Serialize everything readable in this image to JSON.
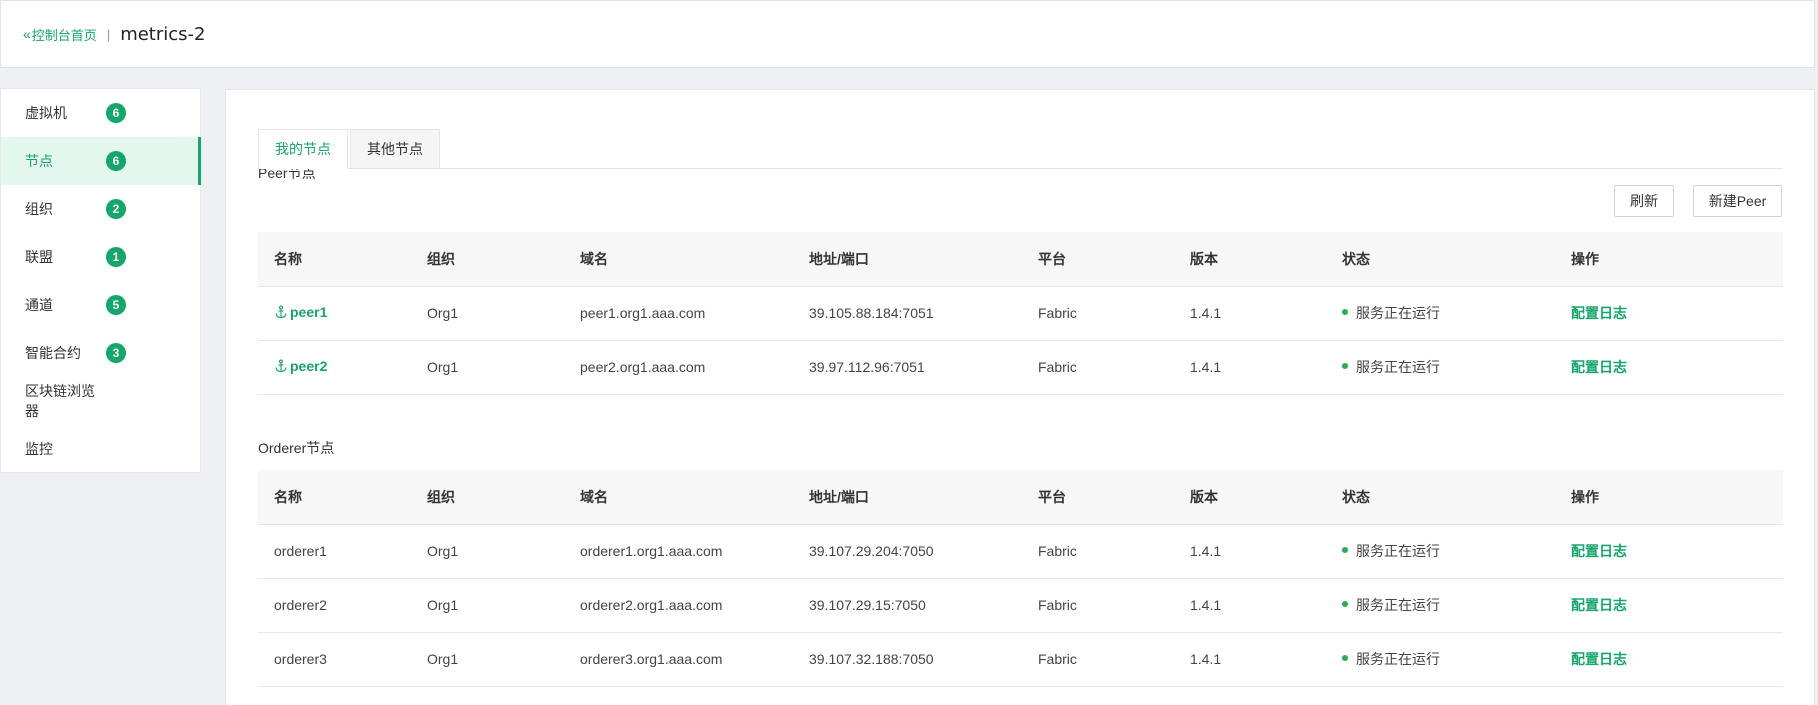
{
  "header": {
    "back_label": "控制台首页",
    "separator": "|",
    "title": "metrics-2"
  },
  "sidebar": {
    "items": [
      {
        "label": "虚拟机",
        "badge": "6"
      },
      {
        "label": "节点",
        "badge": "6"
      },
      {
        "label": "组织",
        "badge": "2"
      },
      {
        "label": "联盟",
        "badge": "1"
      },
      {
        "label": "通道",
        "badge": "5"
      },
      {
        "label": "智能合约",
        "badge": "3"
      },
      {
        "label": "区块链浏览器"
      },
      {
        "label": "监控"
      }
    ]
  },
  "tabs": [
    "我的节点",
    "其他节点"
  ],
  "peer_section": {
    "title": "Peer节点",
    "refresh_label": "刷新",
    "new_label": "新建Peer",
    "columns": [
      "名称",
      "组织",
      "域名",
      "地址/端口",
      "平台",
      "版本",
      "状态",
      "操作"
    ],
    "rows": [
      {
        "name": "peer1",
        "org": "Org1",
        "domain": "peer1.org1.aaa.com",
        "address": "39.105.88.184:7051",
        "platform": "Fabric",
        "version": "1.4.1",
        "status": "服务正在运行",
        "action": "配置日志"
      },
      {
        "name": "peer2",
        "org": "Org1",
        "domain": "peer2.org1.aaa.com",
        "address": "39.97.112.96:7051",
        "platform": "Fabric",
        "version": "1.4.1",
        "status": "服务正在运行",
        "action": "配置日志"
      }
    ]
  },
  "orderer_section": {
    "title": "Orderer节点",
    "columns": [
      "名称",
      "组织",
      "域名",
      "地址/端口",
      "平台",
      "版本",
      "状态",
      "操作"
    ],
    "rows": [
      {
        "name": "orderer1",
        "org": "Org1",
        "domain": "orderer1.org1.aaa.com",
        "address": "39.107.29.204:7050",
        "platform": "Fabric",
        "version": "1.4.1",
        "status": "服务正在运行",
        "action": "配置日志"
      },
      {
        "name": "orderer2",
        "org": "Org1",
        "domain": "orderer2.org1.aaa.com",
        "address": "39.107.29.15:7050",
        "platform": "Fabric",
        "version": "1.4.1",
        "status": "服务正在运行",
        "action": "配置日志"
      },
      {
        "name": "orderer3",
        "org": "Org1",
        "domain": "orderer3.org1.aaa.com",
        "address": "39.107.32.188:7050",
        "platform": "Fabric",
        "version": "1.4.1",
        "status": "服务正在运行",
        "action": "配置日志"
      }
    ]
  },
  "colors": {
    "accent": "#14a66a",
    "status_running": "#23b14d"
  }
}
